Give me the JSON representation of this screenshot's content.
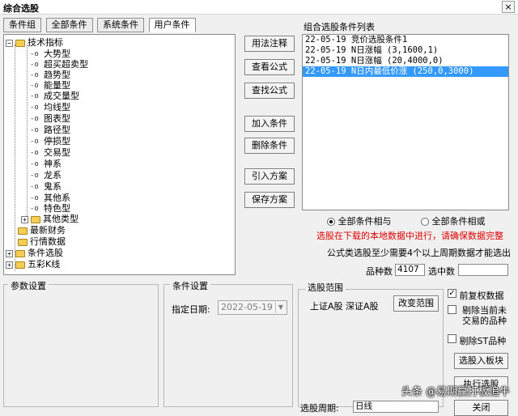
{
  "window": {
    "title": "综合选股",
    "close_label": "×"
  },
  "tabs": [
    {
      "label": "条件组"
    },
    {
      "label": "全部条件"
    },
    {
      "label": "系统条件"
    },
    {
      "label": "用户条件"
    }
  ],
  "tree": {
    "root": {
      "label": "技术指标",
      "expander": "−"
    },
    "children": [
      "大势型",
      "超买超卖型",
      "趋势型",
      "能量型",
      "成交量型",
      "均线型",
      "图表型",
      "路径型",
      "停损型",
      "交易型",
      "神系",
      "龙系",
      "鬼系",
      "其他系",
      "特色型"
    ],
    "collapsed_child": {
      "label": "其他类型",
      "expander": "+"
    },
    "others": [
      {
        "label": "最新财务",
        "expander": ""
      },
      {
        "label": "行情数据",
        "expander": ""
      },
      {
        "label": "条件选股",
        "expander": "+"
      },
      {
        "label": "五彩K线",
        "expander": "+"
      }
    ]
  },
  "buttons": {
    "usage_note": "用法注释",
    "view_formula": "查看公式",
    "find_formula": "查找公式",
    "add_condition": "加入条件",
    "delete_condition": "删除条件",
    "import_plan": "引入方案",
    "save_plan": "保存方案",
    "change_range": "改变范围",
    "select_into_block": "选股入板块",
    "execute": "执行选股",
    "close": "关闭"
  },
  "condition_list": {
    "title": "组合选股条件列表",
    "items": [
      "22-05-19 竞价选股条件1",
      "22-05-19 N日涨幅  (3,1600,1)",
      "22-05-19 N日涨幅  (20,4000,0)",
      "22-05-19 N日内最低价涨 (250,0,3000)"
    ],
    "selected_index": 3
  },
  "logic": {
    "and_label": "全部条件相与",
    "or_label": "全部条件相或",
    "selected": "and"
  },
  "notes": {
    "red_warning": "选股在下载的本地数据中进行，请确保数据完整",
    "formula_note": "公式类选股至少需要4个以上周期数据才能选出"
  },
  "counts": {
    "stock_count_label": "品种数",
    "stock_count_value": "4107",
    "selected_label": "选中数",
    "selected_value": ""
  },
  "params_group": {
    "title": "参数设置"
  },
  "condition_settings": {
    "title": "条件设置",
    "date_label": "指定日期:",
    "date_value": "2022-05-19",
    "date_arrow": "▼"
  },
  "range_group": {
    "title": "选股范围",
    "markets": "上证A股  深证A股"
  },
  "options": {
    "prev_rights": {
      "label": "前复权数据",
      "checked": true
    },
    "exclude_no_trade": {
      "label_line1": "剔除当前未",
      "label_line2": "交易的品种",
      "checked": false
    },
    "exclude_st": {
      "label": "剔除ST品种",
      "checked": false
    }
  },
  "period": {
    "label": "选股周期:",
    "value": "日线"
  },
  "watermark": {
    "text": "头条 @易期赢打板追牛"
  }
}
